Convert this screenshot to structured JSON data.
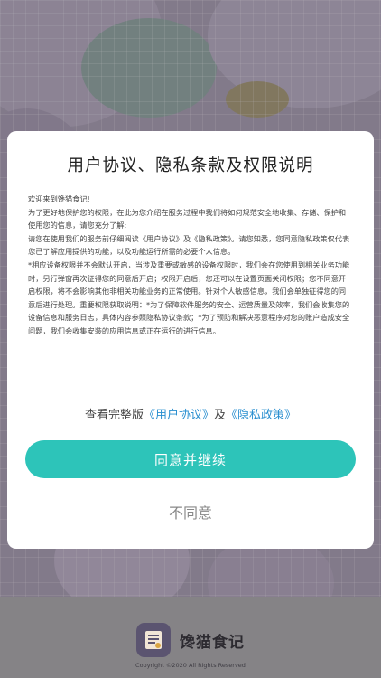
{
  "dialog": {
    "title": "用户协议、隐私条款及权限说明",
    "paragraphs": [
      "欢迎来到馋猫食记!",
      "为了更好地保护您的权限，在此为您介绍在服务过程中我们将如何规范安全地收集、存储、保护和使用您的信息，请您充分了解:",
      "请您在使用我们的服务前仔细阅读《用户协议》及《隐私政策》。请您知悉，您同意隐私政策仅代表您已了解应用提供的功能，以及功能运行所需的必要个人信息。",
      "*相应设备权限并不会默认开启，当涉及重要或敏感的设备权限时，我们会在您使用到相关业务功能时，另行弹窗再次征得您的同意后开启；权限开启后，您还可以在设置页面关闭权限；您不同意开启权限，将不会影响其他非相关功能业务的正常使用。针对个人敏感信息，我们会单独征得您的同意后进行处理。重要权限获取说明：*为了保障软件服务的安全、运营质量及效率，我们会收集您的设备信息和服务日志，具体内容参照隐私协议条款；*为了预防和解决恶意程序对您的账户造成安全问题，我们会收集安装的应用信息或正在运行的进行信息。"
    ],
    "links_prefix": "查看完整版",
    "user_agreement_link": "《用户协议》",
    "links_and": "及",
    "privacy_policy_link": "《隐私政策》",
    "agree_label": "同意并继续",
    "disagree_label": "不同意"
  },
  "brand": {
    "app_name": "馋猫食记",
    "copyright": "Copyright ©2020 All Rights Reserved",
    "logo_icon": "cat-notebook-icon"
  },
  "colors": {
    "accent": "#2dc4b9",
    "link": "#2a8fd0"
  }
}
